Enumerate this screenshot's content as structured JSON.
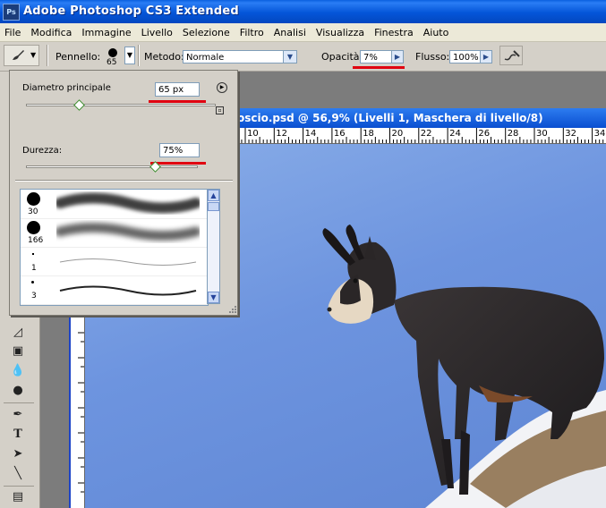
{
  "window": {
    "app_title": "Adobe Photoshop CS3 Extended",
    "logo_text": "Ps"
  },
  "menu": [
    "File",
    "Modifica",
    "Immagine",
    "Livello",
    "Selezione",
    "Filtro",
    "Analisi",
    "Visualizza",
    "Finestra",
    "Aiuto"
  ],
  "options": {
    "brush_label": "Pennello:",
    "brush_size": "65",
    "mode_label": "Metodo:",
    "mode_value": "Normale",
    "opacity_label": "Opacità:",
    "opacity_value": "7%",
    "flow_label": "Flusso:",
    "flow_value": "100%"
  },
  "brush_panel": {
    "diameter_label": "Diametro principale",
    "diameter_value": "65 px",
    "diameter_level": 0.28,
    "hardness_label": "Durezza:",
    "hardness_value": "75%",
    "hardness_level": 0.75,
    "presets": [
      {
        "size": "30"
      },
      {
        "size": "166"
      },
      {
        "size": "1"
      },
      {
        "size": "3"
      }
    ]
  },
  "document": {
    "title": "oscio.psd @ 56,9% (Livelli 1, Maschera di livello/8)",
    "ruler_numbers": [
      "10",
      "12",
      "14",
      "16",
      "18",
      "20",
      "22",
      "24",
      "26",
      "28",
      "30",
      "32",
      "34"
    ]
  },
  "colors": {
    "title_blue": "#0455d8",
    "highlight_red": "#e00010",
    "sky_blue": "#6d94df"
  }
}
